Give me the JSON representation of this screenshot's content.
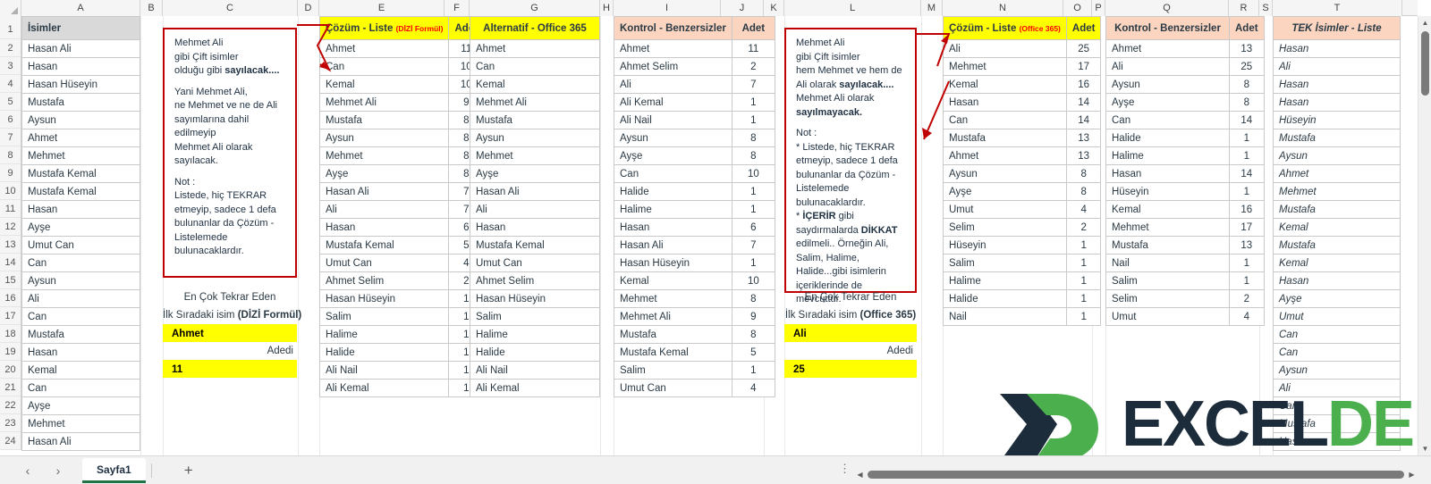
{
  "window": {
    "sheet_tab": "Sayfa1",
    "add_sheet_icon": "plus-icon",
    "prev_sheet_icon": "chevron-left-icon",
    "next_sheet_icon": "chevron-right-icon",
    "status_ellipsis": "⋮"
  },
  "colors": {
    "header_yellow": "#ffff00",
    "header_peach": "#fbd5c0",
    "header_gray": "#d9d9d9",
    "note_border": "#c00000",
    "accent_red": "#ff0000",
    "excel_green": "#217346",
    "logo_dark": "#1c2c3b",
    "logo_green": "#4caf4e"
  },
  "column_headers": [
    "A",
    "B",
    "C",
    "D",
    "E",
    "F",
    "G",
    "H",
    "I",
    "J",
    "K",
    "L",
    "M",
    "N",
    "O",
    "P",
    "Q",
    "R",
    "S",
    "T"
  ],
  "row_headers": [
    "1",
    "2",
    "3",
    "4",
    "5",
    "6",
    "7",
    "8",
    "9",
    "10",
    "11",
    "12",
    "13",
    "14",
    "15",
    "16",
    "17",
    "18",
    "19",
    "20",
    "21",
    "22",
    "23",
    "24"
  ],
  "isimler": {
    "header": "İsimler",
    "values": [
      "Hasan Ali",
      "Hasan",
      "Hasan Hüseyin",
      "Mustafa",
      "Aysun",
      "Ahmet",
      "Mehmet",
      "Mustafa Kemal",
      "Mustafa Kemal",
      "Hasan",
      "Ayşe",
      "Umut Can",
      "Can",
      "Aysun",
      "Ali",
      "Can",
      "Mustafa",
      "Hasan",
      "Kemal",
      "Can",
      "Ayşe",
      "Mehmet",
      "Hasan Ali"
    ]
  },
  "note1": {
    "lines": [
      "Mehmet Ali",
      "gibi Çift isimler",
      "olduğu gibi sayılacak....",
      "",
      "Yani Mehmet Ali,",
      "ne Mehmet ve ne de Ali",
      "sayımlarına dahil",
      "edilmeyip",
      "Mehmet Ali olarak",
      "sayılacak.",
      "",
      "Not :",
      "Listede, hiç TEKRAR",
      "etmeyip, sadece 1 defa",
      "bulunanlar da Çözüm -",
      "Listelemede",
      "bulunacaklardır."
    ]
  },
  "note2": {
    "lines": [
      "Mehmet Ali",
      "gibi Çift isimler",
      "hem Mehmet ve hem de",
      "Ali olarak sayılacak....",
      "Mehmet Ali olarak",
      "sayılmayacak.",
      "",
      "Not :",
      "* Listede, hiç TEKRAR",
      "etmeyip, sadece 1 defa",
      "bulunanlar da Çözüm -",
      "Listelemede",
      "bulunacaklardır.",
      "* İÇERİR gibi",
      "saydırmalarda DİKKAT",
      "edilmeli.. Örneğin Ali,",
      "Salim, Halime,",
      "Halide...gibi isimlerin",
      "içeriklerinde de",
      "mevcuttur."
    ]
  },
  "summary1": {
    "line1": "En Çok Tekrar Eden",
    "line2_plain": "İlk Sıradaki isim ",
    "line2_bold": "(DİZİ Formül)",
    "name": "Ahmet",
    "count_label": "Adedi",
    "count": "11"
  },
  "summary2": {
    "line1": "En Çok Tekrar Eden",
    "line2_plain": "İlk Sıradaki isim ",
    "line2_bold": "(Office 365)",
    "name": "Ali",
    "count_label": "Adedi",
    "count": "25"
  },
  "table_cozum_dizi": {
    "header_main": "Çözüm - Liste",
    "header_note": "(DİZİ Formül)",
    "header_count": "Adet",
    "rows": [
      {
        "name": "Ahmet",
        "count": "11"
      },
      {
        "name": "Can",
        "count": "10"
      },
      {
        "name": "Kemal",
        "count": "10"
      },
      {
        "name": "Mehmet Ali",
        "count": "9"
      },
      {
        "name": "Mustafa",
        "count": "8"
      },
      {
        "name": "Aysun",
        "count": "8"
      },
      {
        "name": "Mehmet",
        "count": "8"
      },
      {
        "name": "Ayşe",
        "count": "8"
      },
      {
        "name": "Hasan Ali",
        "count": "7"
      },
      {
        "name": "Ali",
        "count": "7"
      },
      {
        "name": "Hasan",
        "count": "6"
      },
      {
        "name": "Mustafa Kemal",
        "count": "5"
      },
      {
        "name": "Umut Can",
        "count": "4"
      },
      {
        "name": "Ahmet Selim",
        "count": "2"
      },
      {
        "name": "Hasan Hüseyin",
        "count": "1"
      },
      {
        "name": "Salim",
        "count": "1"
      },
      {
        "name": "Halime",
        "count": "1"
      },
      {
        "name": "Halide",
        "count": "1"
      },
      {
        "name": "Ali Nail",
        "count": "1"
      },
      {
        "name": "Ali Kemal",
        "count": "1"
      }
    ]
  },
  "table_alternatif": {
    "header": "Alternatif - Office 365",
    "rows": [
      "Ahmet",
      "Can",
      "Kemal",
      "Mehmet Ali",
      "Mustafa",
      "Aysun",
      "Mehmet",
      "Ayşe",
      "Hasan Ali",
      "Ali",
      "Hasan",
      "Mustafa Kemal",
      "Umut Can",
      "Ahmet Selim",
      "Hasan Hüseyin",
      "Salim",
      "Halime",
      "Halide",
      "Ali Nail",
      "Ali Kemal"
    ]
  },
  "table_kontrol1": {
    "header_main": "Kontrol - Benzersizler",
    "header_count": "Adet",
    "rows": [
      {
        "name": "Ahmet",
        "count": "11"
      },
      {
        "name": "Ahmet Selim",
        "count": "2"
      },
      {
        "name": "Ali",
        "count": "7"
      },
      {
        "name": "Ali Kemal",
        "count": "1"
      },
      {
        "name": "Ali Nail",
        "count": "1"
      },
      {
        "name": "Aysun",
        "count": "8"
      },
      {
        "name": "Ayşe",
        "count": "8"
      },
      {
        "name": "Can",
        "count": "10"
      },
      {
        "name": "Halide",
        "count": "1"
      },
      {
        "name": "Halime",
        "count": "1"
      },
      {
        "name": "Hasan",
        "count": "6"
      },
      {
        "name": "Hasan Ali",
        "count": "7"
      },
      {
        "name": "Hasan Hüseyin",
        "count": "1"
      },
      {
        "name": "Kemal",
        "count": "10"
      },
      {
        "name": "Mehmet",
        "count": "8"
      },
      {
        "name": "Mehmet Ali",
        "count": "9"
      },
      {
        "name": "Mustafa",
        "count": "8"
      },
      {
        "name": "Mustafa Kemal",
        "count": "5"
      },
      {
        "name": "Salim",
        "count": "1"
      },
      {
        "name": "Umut Can",
        "count": "4"
      }
    ]
  },
  "table_cozum_365": {
    "header_main": "Çözüm - Liste",
    "header_note": "(Office 365)",
    "header_count": "Adet",
    "rows": [
      {
        "name": "Ali",
        "count": "25"
      },
      {
        "name": "Mehmet",
        "count": "17"
      },
      {
        "name": "Kemal",
        "count": "16"
      },
      {
        "name": "Hasan",
        "count": "14"
      },
      {
        "name": "Can",
        "count": "14"
      },
      {
        "name": "Mustafa",
        "count": "13"
      },
      {
        "name": "Ahmet",
        "count": "13"
      },
      {
        "name": "Aysun",
        "count": "8"
      },
      {
        "name": "Ayşe",
        "count": "8"
      },
      {
        "name": "Umut",
        "count": "4"
      },
      {
        "name": "Selim",
        "count": "2"
      },
      {
        "name": "Hüseyin",
        "count": "1"
      },
      {
        "name": "Salim",
        "count": "1"
      },
      {
        "name": "Halime",
        "count": "1"
      },
      {
        "name": "Halide",
        "count": "1"
      },
      {
        "name": "Nail",
        "count": "1"
      }
    ]
  },
  "table_kontrol2": {
    "header_main": "Kontrol - Benzersizler",
    "header_count": "Adet",
    "rows": [
      {
        "name": "Ahmet",
        "count": "13"
      },
      {
        "name": "Ali",
        "count": "25"
      },
      {
        "name": "Aysun",
        "count": "8"
      },
      {
        "name": "Ayşe",
        "count": "8"
      },
      {
        "name": "Can",
        "count": "14"
      },
      {
        "name": "Halide",
        "count": "1"
      },
      {
        "name": "Halime",
        "count": "1"
      },
      {
        "name": "Hasan",
        "count": "14"
      },
      {
        "name": "Hüseyin",
        "count": "1"
      },
      {
        "name": "Kemal",
        "count": "16"
      },
      {
        "name": "Mehmet",
        "count": "17"
      },
      {
        "name": "Mustafa",
        "count": "13"
      },
      {
        "name": "Nail",
        "count": "1"
      },
      {
        "name": "Salim",
        "count": "1"
      },
      {
        "name": "Selim",
        "count": "2"
      },
      {
        "name": "Umut",
        "count": "4"
      }
    ]
  },
  "table_tek_isimler": {
    "header": "TEK İsimler - Liste",
    "rows": [
      "Hasan",
      "Ali",
      "Hasan",
      "Hasan",
      "Hüseyin",
      "Mustafa",
      "Aysun",
      "Ahmet",
      "Mehmet",
      "Mustafa",
      "Kemal",
      "Mustafa",
      "Kemal",
      "Hasan",
      "Ayşe",
      "Umut",
      "Can",
      "Can",
      "Aysun",
      "Ali",
      "Can",
      "Mustafa",
      "Hasan"
    ]
  },
  "watermark": {
    "text_part1": "EXCEL",
    "text_part2": "DEPO",
    "mark": "xd-logo-icon"
  }
}
